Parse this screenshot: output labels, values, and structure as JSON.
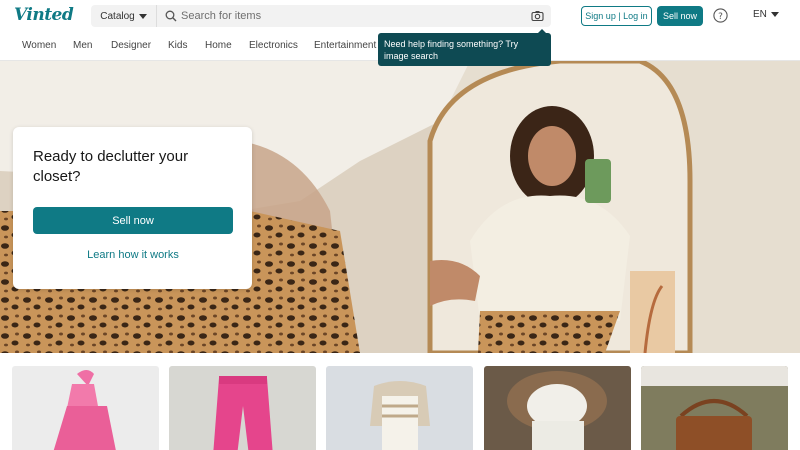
{
  "header": {
    "logo": "Vinted",
    "catalog_label": "Catalog",
    "search_placeholder": "Search for items",
    "signup_login_label": "Sign up | Log in",
    "sell_now_label": "Sell now",
    "language_label": "EN"
  },
  "nav": {
    "items": [
      "Women",
      "Men",
      "Designer",
      "Kids",
      "Home",
      "Electronics",
      "Entertainment"
    ]
  },
  "tooltip": {
    "text": "Need help finding something? Try image search"
  },
  "hero": {
    "title": "Ready to declutter your closet?",
    "sell_now_label": "Sell now",
    "learn_label": "Learn how it works"
  },
  "items": [
    {
      "name": "pink-halter-top"
    },
    {
      "name": "pink-pants"
    },
    {
      "name": "baby-overalls"
    },
    {
      "name": "white-fur-hood-jacket"
    },
    {
      "name": "brown-handbag"
    }
  ],
  "colors": {
    "brand": "#0f7a85",
    "tooltip_bg": "#0e4a53"
  }
}
